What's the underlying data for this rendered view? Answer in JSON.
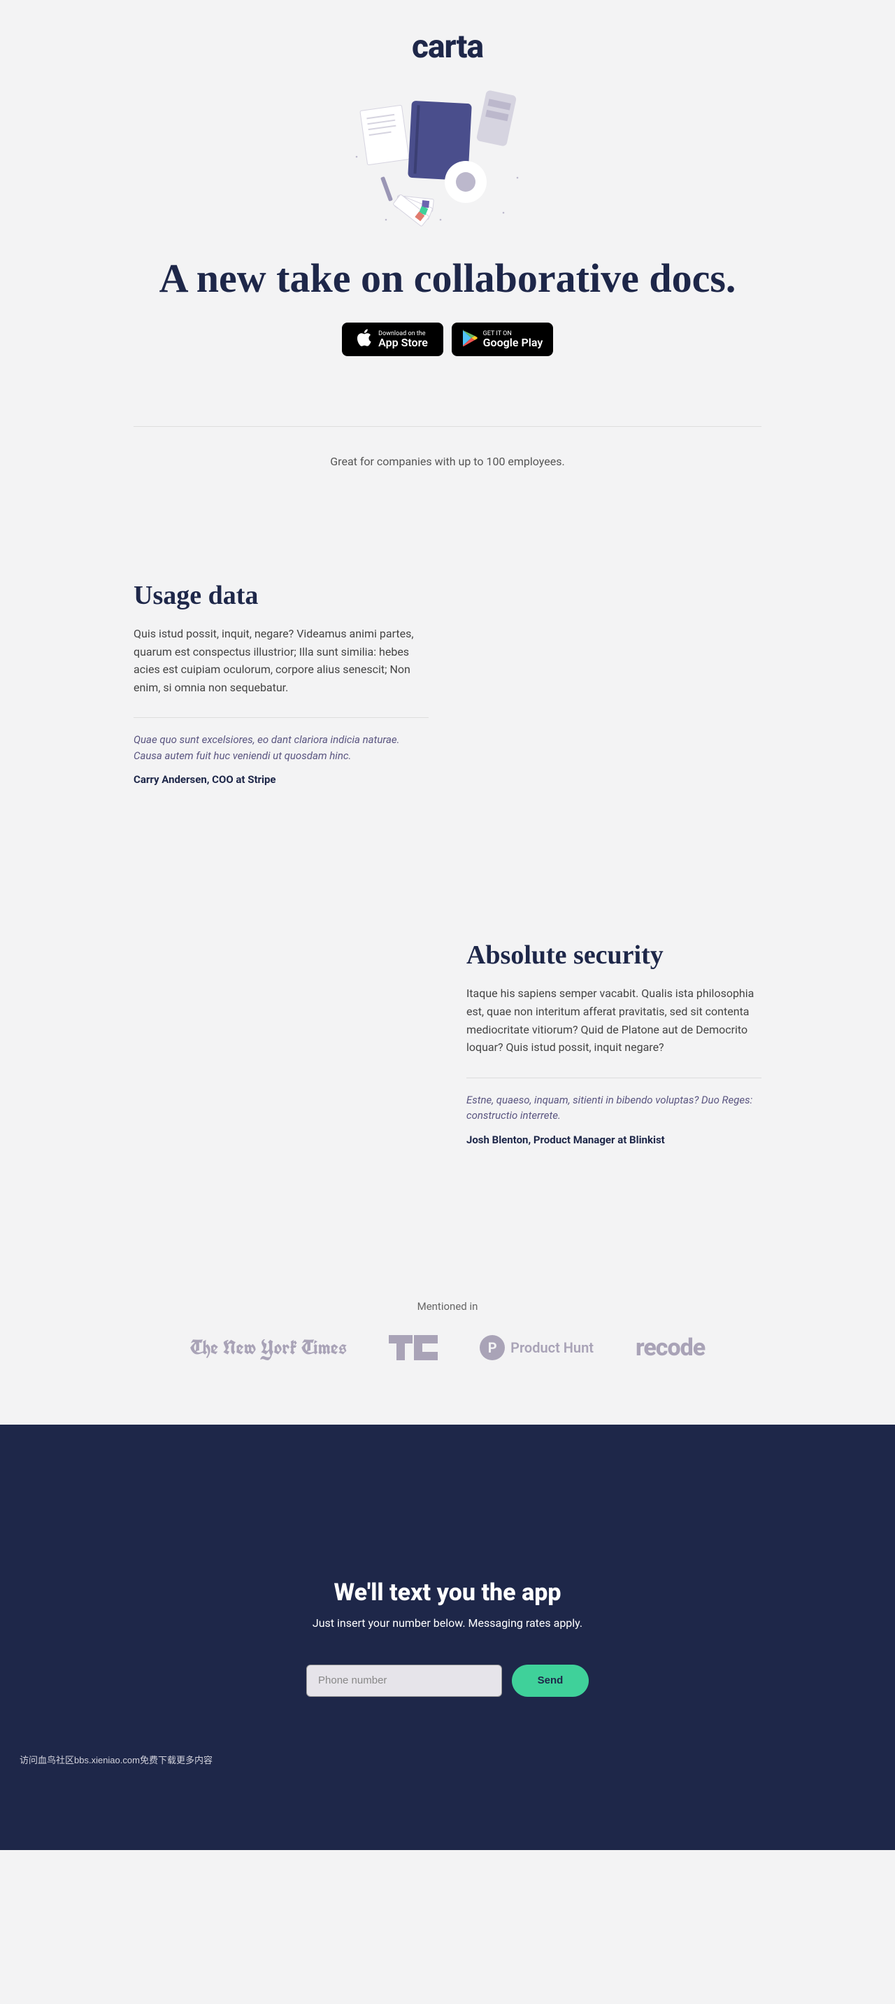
{
  "brand": "carta",
  "hero": {
    "headline": "A new take on collaborative docs.",
    "app_store": {
      "small": "Download on the",
      "big": "App Store"
    },
    "google_play": {
      "small": "GET IT ON",
      "big": "Google Play"
    }
  },
  "tagline": "Great for companies with up to 100 employees.",
  "features": [
    {
      "title": "Usage data",
      "body": "Quis istud possit, inquit, negare? Videamus animi partes, quarum est conspectus illustrior; Illa sunt similia: hebes acies est cuipiam oculorum, corpore alius senescit; Non enim, si omnia non sequebatur.",
      "quote": "Quae quo sunt excelsiores, eo dant clariora indicia naturae. Causa autem fuit huc veniendi ut quosdam hinc.",
      "attribution": "Carry Andersen, COO at Stripe"
    },
    {
      "title": "Absolute security",
      "body": "Itaque his sapiens semper vacabit. Qualis ista philosophia est, quae non interitum afferat pravitatis, sed sit contenta mediocritate vitiorum? Quid de Platone aut de Democrito loquar? Quis istud possit, inquit negare?",
      "quote": "Estne, quaeso, inquam, sitienti in bibendo voluptas? Duo Reges: constructio interrete.",
      "attribution": "Josh Blenton, Product Manager at Blinkist"
    }
  ],
  "press": {
    "label": "Mentioned in",
    "logos": {
      "nyt": "The New York Times",
      "product_hunt": "Product Hunt",
      "recode": "recode"
    }
  },
  "footer": {
    "title": "We'll text you the app",
    "subtitle": "Just insert your number below. Messaging rates apply.",
    "phone_placeholder": "Phone number",
    "send_label": "Send"
  },
  "fine_print": "访问血鸟社区bbs.xieniao.com免费下载更多内容"
}
